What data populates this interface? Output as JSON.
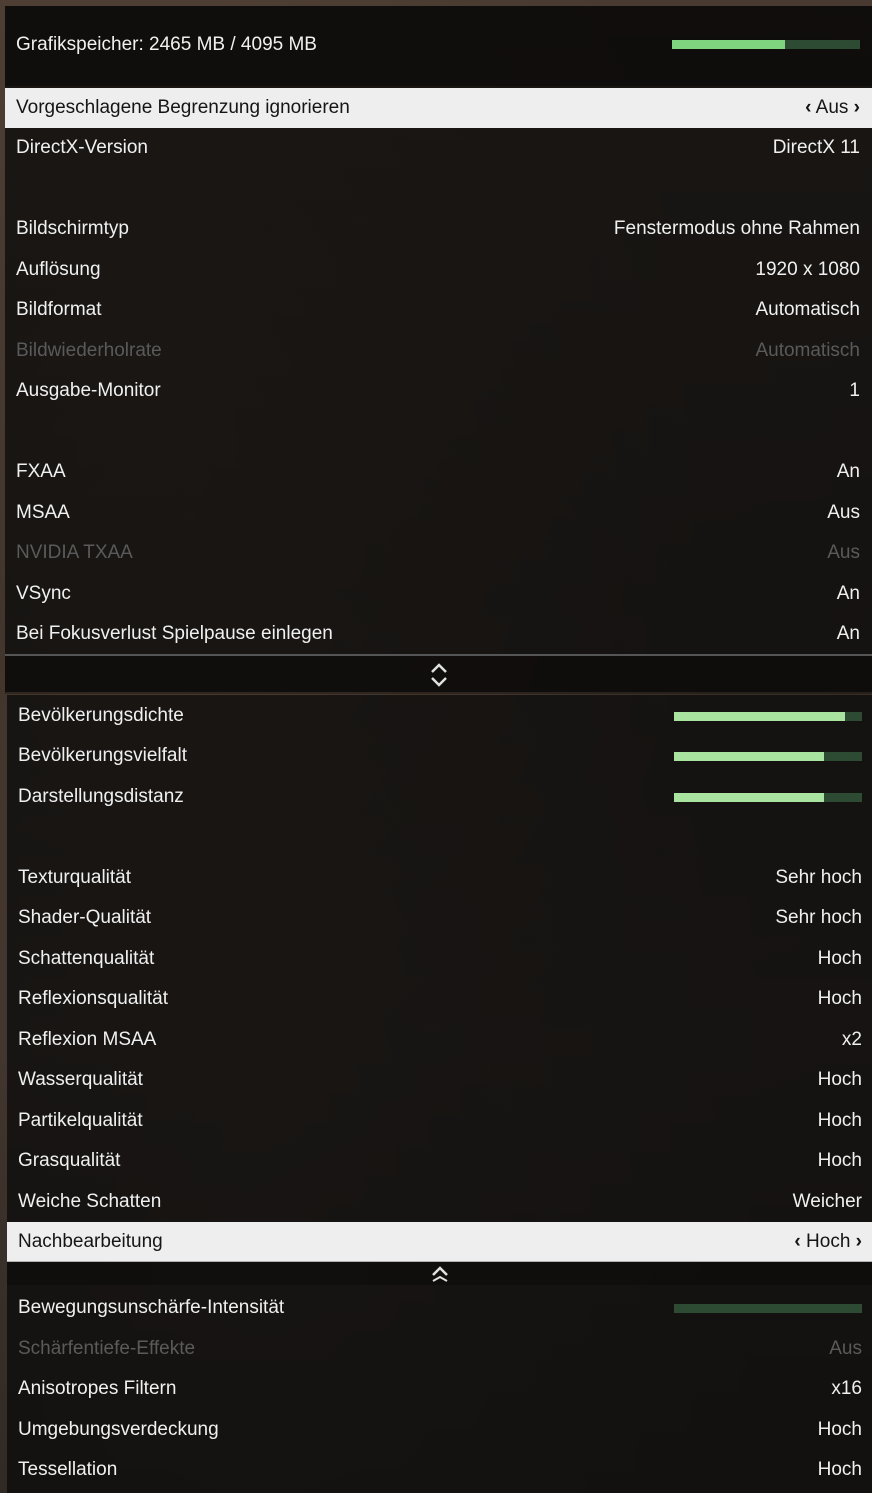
{
  "memory": {
    "label": "Grafikspeicher: 2465 MB / 4095 MB",
    "used_fraction": 0.6
  },
  "panel1": {
    "rows": [
      {
        "label": "Vorgeschlagene Begrenzung ignorieren",
        "value": "Aus",
        "selected": true
      },
      {
        "label": "DirectX-Version",
        "value": "DirectX 11"
      },
      {
        "label": "Bildschirmtyp",
        "value": "Fenstermodus ohne Rahmen"
      },
      {
        "label": "Auflösung",
        "value": "1920 x 1080"
      },
      {
        "label": "Bildformat",
        "value": "Automatisch"
      },
      {
        "label": "Bildwiederholrate",
        "value": "Automatisch",
        "disabled": true
      },
      {
        "label": "Ausgabe-Monitor",
        "value": "1"
      },
      {
        "label": "FXAA",
        "value": "An"
      },
      {
        "label": "MSAA",
        "value": "Aus"
      },
      {
        "label": "NVIDIA TXAA",
        "value": "Aus",
        "disabled": true
      },
      {
        "label": "VSync",
        "value": "An"
      },
      {
        "label": "Bei Fokusverlust Spielpause einlegen",
        "value": "An"
      }
    ]
  },
  "panel2": {
    "sliders": [
      {
        "label": "Bevölkerungsdichte",
        "level": 0.91
      },
      {
        "label": "Bevölkerungsvielfalt",
        "level": 0.8
      },
      {
        "label": "Darstellungsdistanz",
        "level": 0.8
      }
    ],
    "rows": [
      {
        "label": "Texturqualität",
        "value": "Sehr hoch"
      },
      {
        "label": "Shader-Qualität",
        "value": "Sehr hoch"
      },
      {
        "label": "Schattenqualität",
        "value": "Hoch"
      },
      {
        "label": "Reflexionsqualität",
        "value": "Hoch"
      },
      {
        "label": "Reflexion MSAA",
        "value": "x2"
      },
      {
        "label": "Wasserqualität",
        "value": "Hoch"
      },
      {
        "label": "Partikelqualität",
        "value": "Hoch"
      },
      {
        "label": "Grasqualität",
        "value": "Hoch"
      },
      {
        "label": "Weiche Schatten",
        "value": "Weicher"
      },
      {
        "label": "Nachbearbeitung",
        "value": "Hoch",
        "selected": true
      }
    ],
    "lower": {
      "motion_blur": {
        "label": "Bewegungsunschärfe-Intensität",
        "level": 0.0
      },
      "rows": [
        {
          "label": "Schärfentiefe-Effekte",
          "value": "Aus",
          "disabled": true
        },
        {
          "label": "Anisotropes Filtern",
          "value": "x16"
        },
        {
          "label": "Umgebungsverdeckung",
          "value": "Hoch"
        },
        {
          "label": "Tessellation",
          "value": "Hoch"
        }
      ]
    }
  },
  "colors": {
    "bar_fill": "#7fd47f",
    "bar_track": "#2d4a32",
    "selected_bg": "#eeeeee"
  }
}
